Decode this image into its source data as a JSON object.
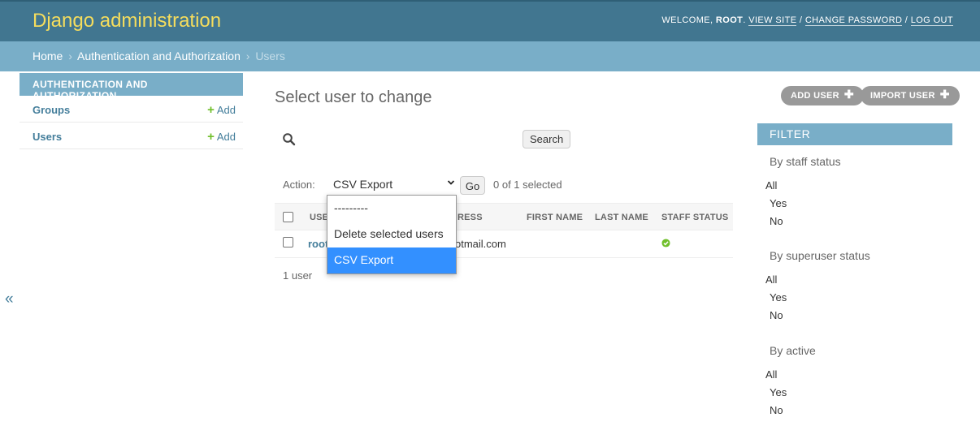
{
  "header": {
    "branding": "Django administration",
    "welcome": "WELCOME, ",
    "username": "ROOT",
    "period": ". ",
    "view_site": "VIEW SITE",
    "change_password": "CHANGE PASSWORD",
    "log_out": "LOG OUT",
    "separator": " / "
  },
  "breadcrumbs": {
    "home": "Home",
    "app": "Authentication and Authorization",
    "current": "Users",
    "sep": "›"
  },
  "sidebar": {
    "app_caption": "AUTHENTICATION AND AUTHORIZATION",
    "models": [
      {
        "name": "Groups",
        "add": "Add"
      },
      {
        "name": "Users",
        "add": "Add"
      }
    ],
    "toggle": "«"
  },
  "content": {
    "title": "Select user to change",
    "object_tools": {
      "add_user": "ADD USER",
      "import_user": "IMPORT USER"
    },
    "search_button": "Search",
    "action_label": "Action:",
    "action_selected": "CSV Export",
    "go_button": "Go",
    "selection_count": "0 of 1 selected",
    "dropdown_options": [
      "---------",
      "Delete selected users",
      "CSV Export"
    ],
    "table": {
      "headers": [
        "USERNAME",
        "EMAIL ADDRESS",
        "FIRST NAME",
        "LAST NAME",
        "STAFF STATUS"
      ],
      "visible_headers": {
        "username": "USE",
        "email": "RESS",
        "first_name": "FIRST NAME",
        "last_name": "LAST NAME",
        "staff_status": "STAFF STATUS"
      },
      "rows": [
        {
          "username": "root",
          "email_visible": "otmail.com",
          "first_name": "",
          "last_name": "",
          "staff_status": true
        }
      ]
    },
    "paginator": "1 user"
  },
  "filter": {
    "caption": "FILTER",
    "groups": [
      {
        "title": "By staff status",
        "choices": [
          "All",
          "Yes",
          "No"
        ]
      },
      {
        "title": "By superuser status",
        "choices": [
          "All",
          "Yes",
          "No"
        ]
      },
      {
        "title": "By active",
        "choices": [
          "All",
          "Yes",
          "No"
        ]
      }
    ]
  },
  "colors": {
    "header_bg": "#417690",
    "branding": "#f5dd5d",
    "breadcrumb_bg": "#79aec8",
    "link": "#447e9b",
    "add_green": "#70bf2b",
    "selected_option": "#3390ff"
  }
}
